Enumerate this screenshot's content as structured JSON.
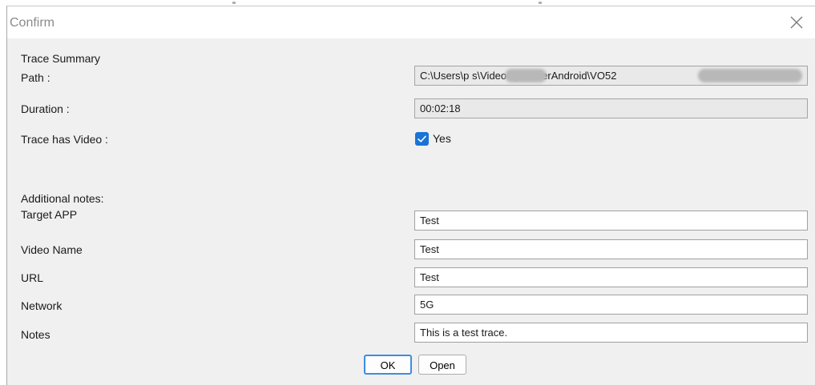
{
  "dialog": {
    "title": "Confirm",
    "close_icon": "close-icon"
  },
  "summary": {
    "heading": "Trace Summary",
    "path_label": "Path :",
    "path_value": "C:\\Users\\p          s\\VideoOptimizerAndroid\\VO52",
    "duration_label": "Duration :",
    "duration_value": "00:02:18",
    "video_label": "Trace has Video :",
    "video_checked": true,
    "video_value": "Yes"
  },
  "notes": {
    "heading": "Additional notes:",
    "fields": [
      {
        "label": "Target APP",
        "value": "Test"
      },
      {
        "label": "Video Name",
        "value": "Test"
      },
      {
        "label": "URL",
        "value": "Test"
      },
      {
        "label": "Network",
        "value": "5G"
      },
      {
        "label": "Notes",
        "value": "This is a test trace."
      }
    ]
  },
  "buttons": {
    "ok": "OK",
    "open": "Open"
  },
  "colors": {
    "accent": "#1a73d6",
    "dialog_bg": "#f0f0f0"
  }
}
